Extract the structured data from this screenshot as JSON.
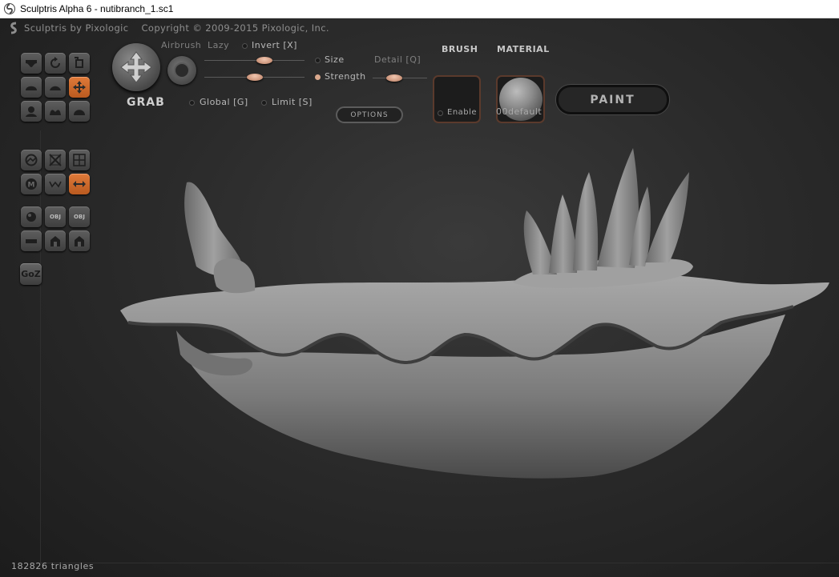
{
  "window": {
    "title": "Sculptris Alpha 6 - nutibranch_1.sc1"
  },
  "header": {
    "brand": "Sculptris by Pixologic",
    "copyright": "Copyright © 2009-2015 Pixologic, Inc."
  },
  "tools": {
    "current_tool": "GRAB",
    "airbrush_label": "Airbrush",
    "lazy_label": "Lazy",
    "invert_label": "Invert [X]",
    "size_label": "Size",
    "strength_label": "Strength",
    "detail_label": "Detail [Q]",
    "global_label": "Global [G]",
    "limit_label": "Limit [S]",
    "options_label": "OPTIONS",
    "size_value": 0.6,
    "strength_value": 0.5,
    "detail_value": 0.4,
    "invert_checked": false,
    "size_selected": false,
    "strength_selected": true,
    "global_checked": false,
    "limit_checked": false
  },
  "brush": {
    "label": "BRUSH",
    "enable_label": "Enable",
    "enabled": false
  },
  "material": {
    "label": "MATERIAL",
    "name": "00default"
  },
  "paint_button": "PAINT",
  "palette": {
    "goz_label": "GoZ",
    "obj_import_label": "OBJ",
    "obj_export_label": "OBJ",
    "icons": [
      "draw-icon",
      "rotate-icon",
      "scale-icon",
      "inflate-icon",
      "flatten-icon",
      "grab-icon",
      "pinch-icon",
      "crease-icon",
      "smooth-icon",
      "reduce-brush-icon",
      "reduce-selection-icon",
      "subdivide-icon",
      "mask-icon",
      "wireframe-icon",
      "symmetry-icon",
      "sphere-icon",
      "import-obj-icon",
      "export-obj-icon",
      "plane-icon",
      "open-icon",
      "save-icon"
    ],
    "active": [
      "grab-icon",
      "symmetry-icon"
    ]
  },
  "status": {
    "triangles": "182826 triangles"
  },
  "colors": {
    "accent": "#d9742f",
    "slider_knob": "#d9a88c",
    "model_gray": "#8a8a8a"
  }
}
